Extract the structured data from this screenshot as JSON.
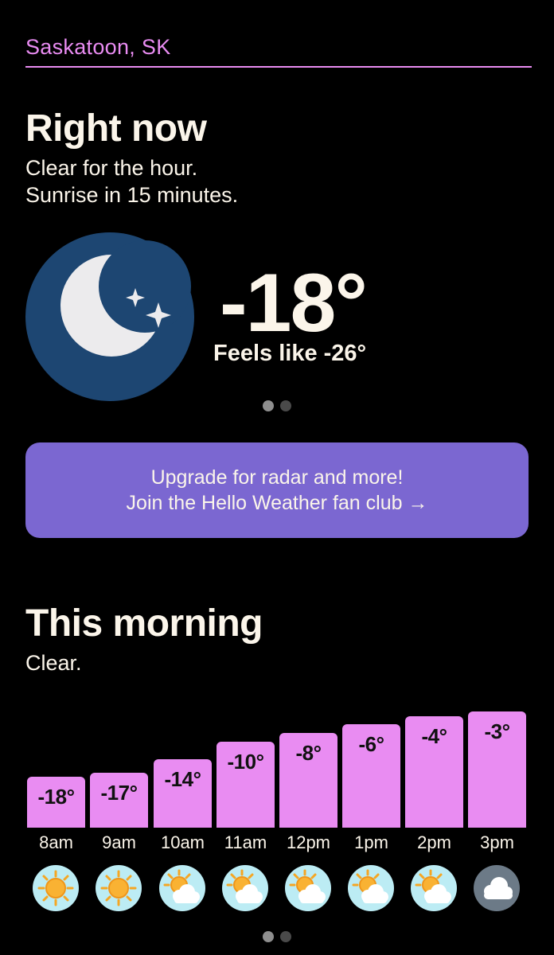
{
  "location": "Saskatoon, SK",
  "right_now": {
    "title": "Right now",
    "line1": "Clear for the hour.",
    "line2": "Sunrise in 15 minutes.",
    "icon": "moon-stars-icon",
    "temperature": "-18°",
    "feels_like": "Feels like -26°"
  },
  "upgrade": {
    "line1": "Upgrade for radar and more!",
    "line2": "Join the Hello Weather fan club →"
  },
  "this_morning": {
    "title": "This morning",
    "summary": "Clear."
  },
  "colors": {
    "accent": "#e98cf2",
    "banner": "#7b67d1",
    "moon_bg": "#1d4672",
    "text": "#fbf5ea"
  },
  "hourly": [
    {
      "time": "8am",
      "temp": -18,
      "temp_label": "-18°",
      "icon": "sun-icon"
    },
    {
      "time": "9am",
      "temp": -17,
      "temp_label": "-17°",
      "icon": "sun-icon"
    },
    {
      "time": "10am",
      "temp": -14,
      "temp_label": "-14°",
      "icon": "partly-cloudy-icon"
    },
    {
      "time": "11am",
      "temp": -10,
      "temp_label": "-10°",
      "icon": "partly-cloudy-icon"
    },
    {
      "time": "12pm",
      "temp": -8,
      "temp_label": "-8°",
      "icon": "partly-cloudy-icon"
    },
    {
      "time": "1pm",
      "temp": -6,
      "temp_label": "-6°",
      "icon": "partly-cloudy-icon"
    },
    {
      "time": "2pm",
      "temp": -4,
      "temp_label": "-4°",
      "icon": "partly-cloudy-icon"
    },
    {
      "time": "3pm",
      "temp": -3,
      "temp_label": "-3°",
      "icon": "cloudy-icon"
    }
  ],
  "chart_data": {
    "type": "bar",
    "categories": [
      "8am",
      "9am",
      "10am",
      "11am",
      "12pm",
      "1pm",
      "2pm",
      "3pm"
    ],
    "values": [
      -18,
      -17,
      -14,
      -10,
      -8,
      -6,
      -4,
      -3
    ],
    "title": "",
    "xlabel": "",
    "ylabel": ""
  }
}
